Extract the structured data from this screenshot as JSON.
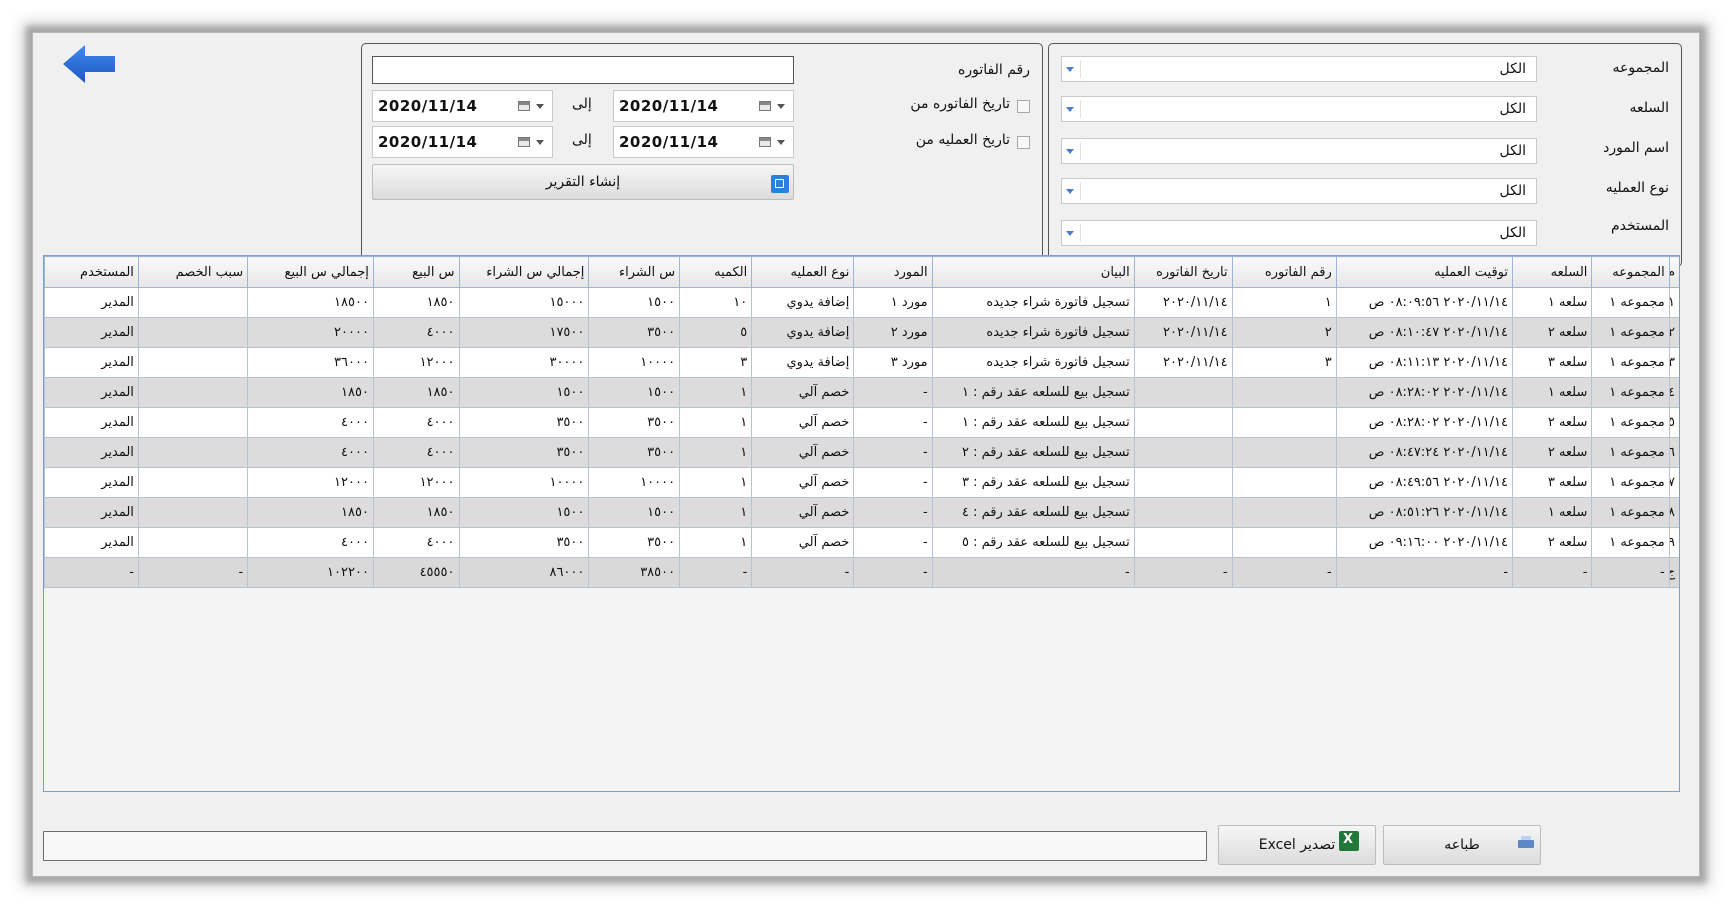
{
  "filters": {
    "group": {
      "label": "المجموعه",
      "value": "الكل"
    },
    "item": {
      "label": "السلعه",
      "value": "الكل"
    },
    "supplier": {
      "label": "اسم المورد",
      "value": "الكل"
    },
    "operation_type": {
      "label": "نوع العمليه",
      "value": "الكل"
    },
    "user": {
      "label": "المستخدم",
      "value": "الكل"
    }
  },
  "invoice": {
    "number_label": "رقم الفاتوره",
    "number_value": "",
    "invoice_date_from_label": "تاريخ الفاتوره من",
    "operation_date_from_label": "تاريخ العمليه من",
    "to_label": "إلى",
    "invoice_date_from": "2020/11/14",
    "invoice_date_to": "2020/11/14",
    "operation_date_from": "2020/11/14",
    "operation_date_to": "2020/11/14"
  },
  "buttons": {
    "create_report": "إنشاء التقرير",
    "export_excel": "تصدير Excel",
    "print": "طباعه"
  },
  "progress": {
    "value": 0
  },
  "table": {
    "headers": [
      "م",
      "المجموعه",
      "السلعه",
      "توقيت العمليه",
      "رقم الفاتوره",
      "تاريخ الفاتوره",
      "البيان",
      "المورد",
      "نوع العمليه",
      "الكميه",
      "س الشراء",
      "إجمالي س الشراء",
      "س البيع",
      "إجمالي س البيع",
      "سبب الخصم",
      "المستخدم"
    ],
    "rows": [
      [
        "١",
        "مجموعه ١",
        "سلعه ١",
        "٢٠٢٠/١١/١٤ ٠٨:٠٩:٥٦ ص",
        "١",
        "٢٠٢٠/١١/١٤",
        "تسجيل فاتورة شراء جديده",
        "مورد ١",
        "إضافة يدوي",
        "١٠",
        "١٥٠٠",
        "١٥٠٠٠",
        "١٨٥٠",
        "١٨٥٠٠",
        "",
        "المدير"
      ],
      [
        "٢",
        "مجموعه ١",
        "سلعه ٢",
        "٢٠٢٠/١١/١٤ ٠٨:١٠:٤٧ ص",
        "٢",
        "٢٠٢٠/١١/١٤",
        "تسجيل فاتورة شراء جديده",
        "مورد ٢",
        "إضافة يدوي",
        "٥",
        "٣٥٠٠",
        "١٧٥٠٠",
        "٤٠٠٠",
        "٢٠٠٠٠",
        "",
        "المدير"
      ],
      [
        "٣",
        "مجموعه ١",
        "سلعه ٣",
        "٢٠٢٠/١١/١٤ ٠٨:١١:١٣ ص",
        "٣",
        "٢٠٢٠/١١/١٤",
        "تسجيل فاتورة شراء جديده",
        "مورد ٣",
        "إضافة يدوي",
        "٣",
        "١٠٠٠٠",
        "٣٠٠٠٠",
        "١٢٠٠٠",
        "٣٦٠٠٠",
        "",
        "المدير"
      ],
      [
        "٤",
        "مجموعه ١",
        "سلعه ١",
        "٢٠٢٠/١١/١٤ ٠٨:٢٨:٠٢ ص",
        "",
        "",
        "تسجيل بيع للسلعه عقد رقم : ١",
        "-",
        "خصم آلي",
        "١",
        "١٥٠٠",
        "١٥٠٠",
        "١٨٥٠",
        "١٨٥٠",
        "",
        "المدير"
      ],
      [
        "٥",
        "مجموعه ١",
        "سلعه ٢",
        "٢٠٢٠/١١/١٤ ٠٨:٢٨:٠٢ ص",
        "",
        "",
        "تسجيل بيع للسلعه عقد رقم : ١",
        "-",
        "خصم آلي",
        "١",
        "٣٥٠٠",
        "٣٥٠٠",
        "٤٠٠٠",
        "٤٠٠٠",
        "",
        "المدير"
      ],
      [
        "٦",
        "مجموعه ١",
        "سلعه ٢",
        "٢٠٢٠/١١/١٤ ٠٨:٤٧:٢٤ ص",
        "",
        "",
        "تسجيل بيع للسلعه عقد رقم : ٢",
        "-",
        "خصم آلي",
        "١",
        "٣٥٠٠",
        "٣٥٠٠",
        "٤٠٠٠",
        "٤٠٠٠",
        "",
        "المدير"
      ],
      [
        "٧",
        "مجموعه ١",
        "سلعه ٣",
        "٢٠٢٠/١١/١٤ ٠٨:٤٩:٥٦ ص",
        "",
        "",
        "تسجيل بيع للسلعه عقد رقم : ٣",
        "-",
        "خصم آلي",
        "١",
        "١٠٠٠٠",
        "١٠٠٠٠",
        "١٢٠٠٠",
        "١٢٠٠٠",
        "",
        "المدير"
      ],
      [
        "٨",
        "مجموعه ١",
        "سلعه ١",
        "٢٠٢٠/١١/١٤ ٠٨:٥١:٢٦ ص",
        "",
        "",
        "تسجيل بيع للسلعه عقد رقم : ٤",
        "-",
        "خصم آلي",
        "١",
        "١٥٠٠",
        "١٥٠٠",
        "١٨٥٠",
        "١٨٥٠",
        "",
        "المدير"
      ],
      [
        "٩",
        "مجموعه ١",
        "سلعه ٢",
        "٢٠٢٠/١١/١٤ ٠٩:١٦:٠٠ ص",
        "",
        "",
        "تسجيل بيع للسلعه عقد رقم : ٥",
        "-",
        "خصم آلي",
        "١",
        "٣٥٠٠",
        "٣٥٠٠",
        "٤٠٠٠",
        "٤٠٠٠",
        "",
        "المدير"
      ]
    ],
    "total_row": [
      "ج",
      "-",
      "-",
      "-",
      "-",
      "-",
      "-",
      "-",
      "-",
      "-",
      "٣٨٥٠٠",
      "٨٦٠٠٠",
      "٤٥٥٥٠",
      "١٠٢٢٠٠",
      "-",
      "-"
    ]
  },
  "icons": {
    "back": "arrow-left-icon",
    "report": "report-edit-icon",
    "excel": "excel-icon",
    "print": "print-icon",
    "calendar": "calendar-icon",
    "dropdown": "chevron-down-icon"
  },
  "colors": {
    "accent": "#2c6fd6",
    "excel": "#1f7a3a"
  }
}
